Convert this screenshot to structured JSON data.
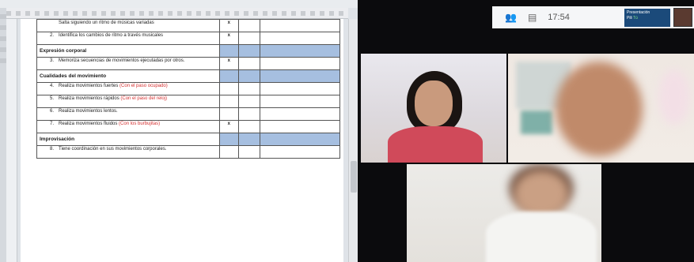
{
  "document": {
    "sections": [
      {
        "type": "item",
        "num": "",
        "text": "Salta siguiendo un ritmo de músicas variadas",
        "mark": "x",
        "note": ""
      },
      {
        "type": "item",
        "num": "2.",
        "text": "Identifica los cambios de ritmo a través musicales",
        "mark": "x",
        "note": ""
      },
      {
        "type": "section",
        "title": "Expresión corporal"
      },
      {
        "type": "item",
        "num": "3.",
        "text": "Memoriza secuencias de movimientos ejecutadas por otros.",
        "mark": "x",
        "note": ""
      },
      {
        "type": "section",
        "title": "Cualidades del movimiento"
      },
      {
        "type": "item",
        "num": "4.",
        "text": "Realiza movimientos fuertes",
        "mark": "",
        "note": "(Con el paso ocupado)"
      },
      {
        "type": "item",
        "num": "5.",
        "text": "Realiza movimientos rápidos",
        "mark": "",
        "note": "(Con el paso del reloj)"
      },
      {
        "type": "item",
        "num": "6.",
        "text": "Realiza movimientos lentos.",
        "mark": "",
        "note": ""
      },
      {
        "type": "item",
        "num": "7.",
        "text": "Realiza movimientos fluidos",
        "mark": "x",
        "note": "(Con los burbujitas)"
      },
      {
        "type": "section",
        "title": "Improvisación"
      },
      {
        "type": "item",
        "num": "8.",
        "text": "Tiene coordinación en sus movimientos corporales.",
        "mark": "",
        "note": ""
      }
    ]
  },
  "meet": {
    "time": "17:54",
    "presenting_label": "Presentación",
    "presenter_short": "Pili",
    "indicator": "Tú",
    "icons": [
      "people-icon",
      "chat-icon"
    ]
  },
  "colors": {
    "section_highlight": "#a6bfe0",
    "note_red": "#d43030",
    "meet_bg": "#0b0b0d"
  }
}
